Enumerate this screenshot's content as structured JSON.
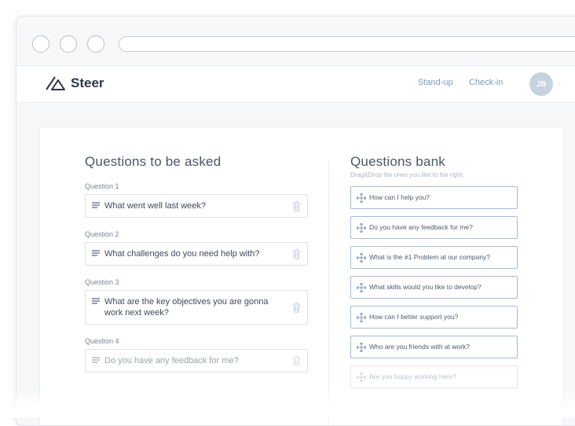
{
  "app": {
    "name": "Steer"
  },
  "nav": {
    "links": [
      "Stand-up",
      "Check-in"
    ],
    "avatar_initials": "JB"
  },
  "left": {
    "title": "Questions to be asked",
    "questions": [
      {
        "label": "Question 1",
        "text": "What went well last week?"
      },
      {
        "label": "Question 2",
        "text": "What challenges do you need help with?"
      },
      {
        "label": "Question 3",
        "text": "What are the key objectives you are gonna work next week?"
      },
      {
        "label": "Question 4",
        "text": "Do you have any feedback for me?"
      }
    ]
  },
  "right": {
    "title": "Questions bank",
    "subtitle": "Drag&Drop the ones you like to the right.",
    "items": [
      "How can I help you?",
      "Do you have any feedback for me?",
      "What is the #1 Problem at our company?",
      "What skills would you like to develop?",
      "How can I better support you?",
      "Who are you friends with at work?",
      "Are you happy working here?"
    ]
  },
  "colors": {
    "accent": "#7f9cb8",
    "border_accent": "#a7bcd5",
    "avatar_bg": "#c7d2e0"
  }
}
